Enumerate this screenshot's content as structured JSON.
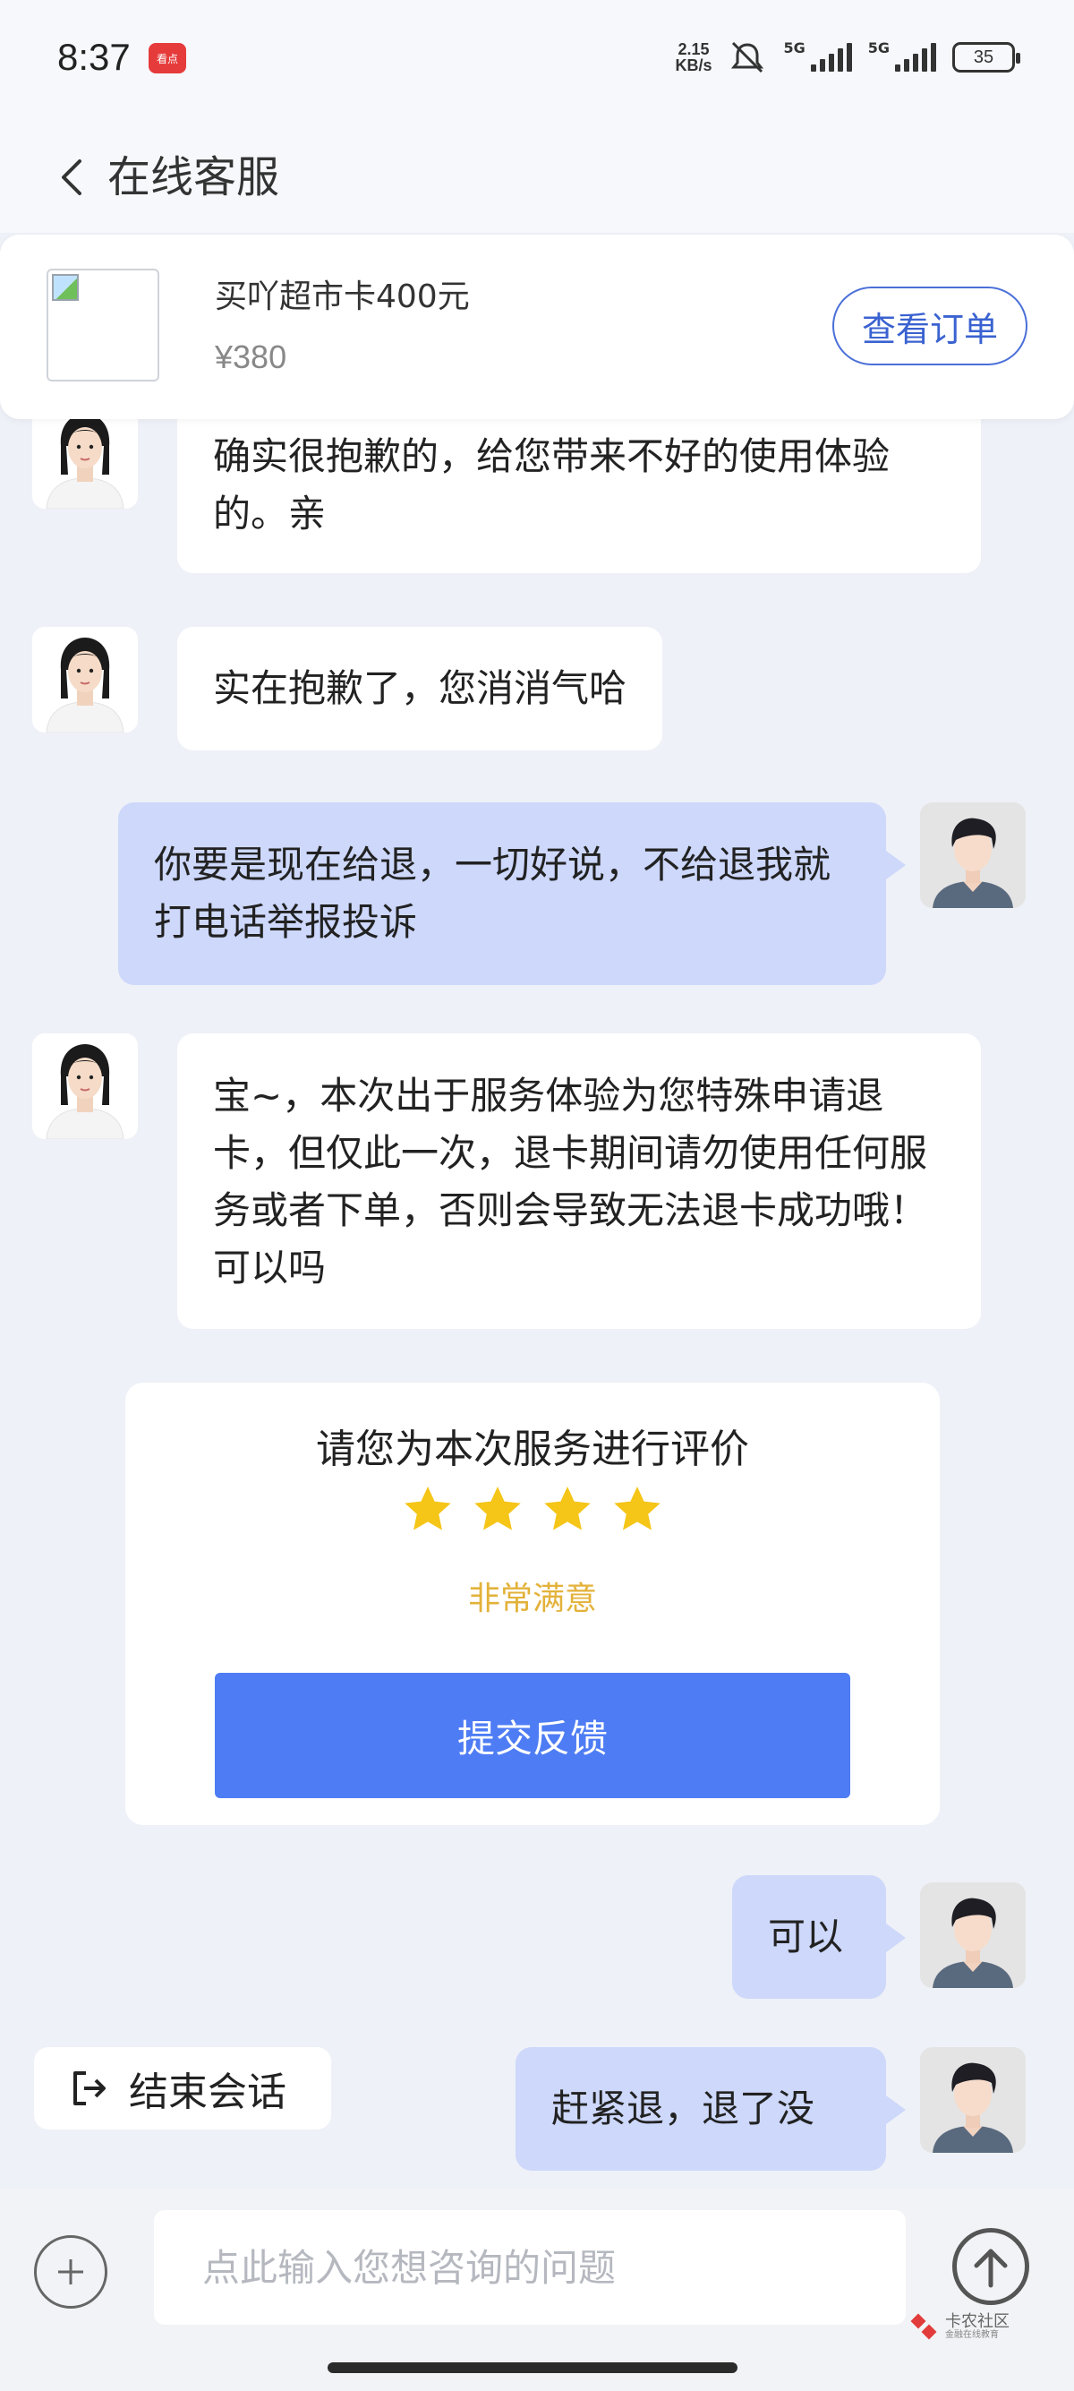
{
  "status_bar": {
    "time": "8:37",
    "app_badge": "看点",
    "net_speed_value": "2.15",
    "net_speed_unit": "KB/s",
    "sim1": "5G",
    "sim2": "5G",
    "battery": "35"
  },
  "header": {
    "title": "在线客服",
    "back_icon": "chevron-left-icon"
  },
  "product": {
    "name": "买吖超市卡400元",
    "price": "¥380",
    "view_order_label": "查看订单"
  },
  "messages": [
    {
      "sender": "agent",
      "text": "确实很抱歉的，给您带来不好的使用体验的。亲"
    },
    {
      "sender": "agent",
      "text": "实在抱歉了，您消消气哈"
    },
    {
      "sender": "user",
      "text": "你要是现在给退，一切好说，不给退我就打电话举报投诉"
    },
    {
      "sender": "agent",
      "text": "宝~，本次出于服务体验为您特殊申请退卡，但仅此一次，退卡期间请勿使用任何服务或者下单，否则会导致无法退卡成功哦！可以吗"
    },
    {
      "sender": "user",
      "text": "可以"
    },
    {
      "sender": "user",
      "text": "赶紧退，退了没"
    }
  ],
  "rating": {
    "title": "请您为本次服务进行评价",
    "stars": 4,
    "star_color": "#f5c518",
    "label": "非常满意",
    "submit_label": "提交反馈"
  },
  "end_session": {
    "label": "结束会话",
    "icon": "exit-icon"
  },
  "input_bar": {
    "placeholder": "点此输入您想咨询的问题",
    "value": "",
    "plus_icon": "plus-icon",
    "send_icon": "arrow-up-icon"
  },
  "watermark": {
    "text": "卡农社区",
    "subtext": "金融在线教育"
  },
  "colors": {
    "accent": "#4e7cf4",
    "user_bubble": "#cdd8fb",
    "background": "#eef1f7"
  }
}
